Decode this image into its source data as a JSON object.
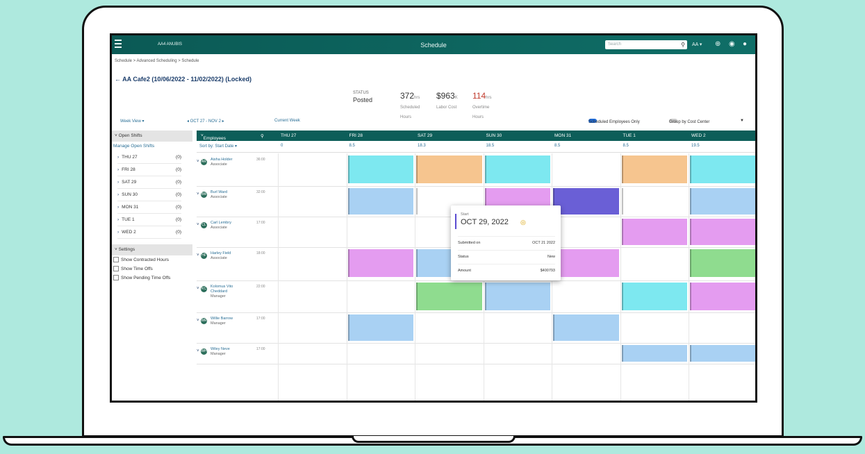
{
  "topbar": {
    "org": "AA4 ANUBIS",
    "title": "Schedule",
    "search_placeholder": "Search",
    "user": "AA ▾"
  },
  "breadcrumb": "Schedule > Advanced Scheduling > Schedule",
  "page_title": "AA Cafe2 (10/06/2022 - 11/02/2022) (Locked)",
  "stats": {
    "status_label": "STATUS",
    "status_value": "Posted",
    "hours_value": "372",
    "hours_unit": "hrs",
    "hours_label": "Scheduled Hours",
    "cost_value": "$963",
    "cost_unit": "K",
    "cost_label": "Labor Cost",
    "ot_value": "114",
    "ot_unit": "hrs",
    "ot_label": "Overtime Hours"
  },
  "toolbar": {
    "view": "Week View ▾",
    "range": "◂ OCT 27 - NOV 2 ▸",
    "current_week": "Current Week",
    "sched_only": "Scheduled Employees Only",
    "group_by": "Group by Cost Center"
  },
  "sidebar": {
    "open_shifts": "Open Shifts",
    "manage": "Manage Open Shifts",
    "days": [
      {
        "label": "THU 27",
        "count": "(0)"
      },
      {
        "label": "FRI 28",
        "count": "(0)"
      },
      {
        "label": "SAT 29",
        "count": "(0)"
      },
      {
        "label": "SUN 30",
        "count": "(0)"
      },
      {
        "label": "MON 31",
        "count": "(0)"
      },
      {
        "label": "TUE 1",
        "count": "(0)"
      },
      {
        "label": "WED 2",
        "count": "(0)"
      }
    ],
    "settings": "Settings",
    "checks": [
      "Show Contracted Hours",
      "Show Time Offs",
      "Show Pending Time Offs"
    ]
  },
  "grid": {
    "employees_label": "Employees",
    "sort_label": "Sort by: Start Date ▾",
    "days": [
      "THU 27",
      "FRI 28",
      "SAT 29",
      "SUN 30",
      "MON 31",
      "TUE 1",
      "WED 2"
    ],
    "day_totals": [
      "0",
      "8.5",
      "18.3",
      "18.5",
      "8.5",
      "8.5",
      "19.5"
    ]
  },
  "employees": [
    {
      "initials": "AR",
      "name": "Aisha Holder",
      "role": "Associate",
      "hours": "36:00"
    },
    {
      "initials": "BW",
      "name": "Burl Ward",
      "role": "Associate",
      "hours": "32:00"
    },
    {
      "initials": "CL",
      "name": "Carl Lembry",
      "role": "Associate",
      "hours": "17:00"
    },
    {
      "initials": "HF",
      "name": "Harley Field",
      "role": "Associate",
      "hours": "18:00"
    },
    {
      "initials": "KC",
      "name": "Kolomus Vito Cheddard",
      "role": "Manager",
      "hours": "22:00"
    },
    {
      "initials": "WR",
      "name": "Willie Barrow",
      "role": "Manager",
      "hours": "17:00"
    },
    {
      "initials": "WH",
      "name": "Wiley Neve",
      "role": "Manager",
      "hours": "17:00"
    }
  ],
  "popup": {
    "label": "Start",
    "date": "OCT 29, 2022",
    "row1_label": "Submitted on",
    "row1_value": "OCT 21 2022",
    "row2_label": "Status",
    "row2_value": "New",
    "row3_label": "Amount",
    "row3_value": "$400793"
  }
}
